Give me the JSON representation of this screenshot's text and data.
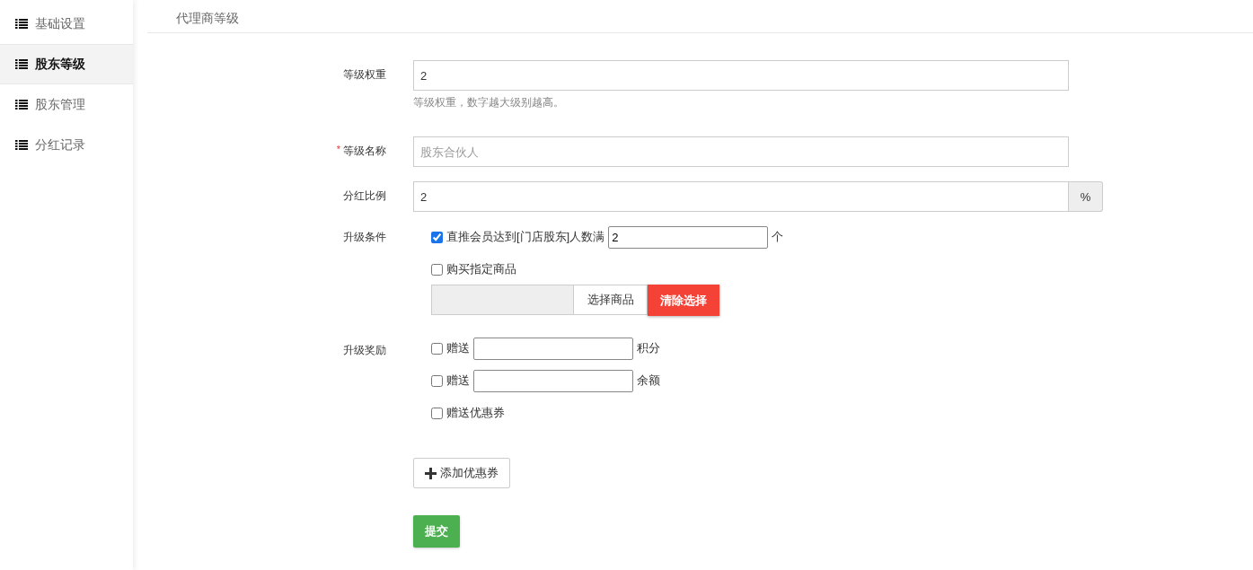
{
  "sidebar": {
    "items": [
      {
        "label": "基础设置",
        "selected": false
      },
      {
        "label": "股东等级",
        "selected": true
      },
      {
        "label": "股东管理",
        "selected": false
      },
      {
        "label": "分红记录",
        "selected": false
      }
    ]
  },
  "page_title": "代理商等级",
  "form": {
    "fields": [
      {
        "kind": "text",
        "label": "等级权重",
        "value": "2",
        "help": "等级权重，数字越大级别越高。"
      },
      {
        "kind": "text",
        "label": "等级名称",
        "required_mark": "*",
        "placeholder": "股东合伙人"
      },
      {
        "kind": "addon",
        "label": "分红比例",
        "value": "2",
        "addon": "%"
      }
    ],
    "upgrade_conditions": {
      "label": "升级条件",
      "options": [
        {
          "kind": "count",
          "checked": true,
          "label": "直推会员达到[门店股东]人数满",
          "value": "2",
          "unit": "个"
        },
        {
          "kind": "goods",
          "checked": false,
          "label": "购买指定商品"
        }
      ],
      "goods_picker": {
        "select_button": "选择商品",
        "clear_button": "清除选择"
      }
    },
    "rewards": {
      "label": "升级奖励",
      "options": [
        {
          "kind": "amount",
          "checked": false,
          "label": "赠送",
          "unit": "积分"
        },
        {
          "kind": "amount",
          "checked": false,
          "label": "赠送",
          "unit": "余额"
        },
        {
          "kind": "plain",
          "checked": false,
          "label": "赠送优惠券"
        }
      ]
    },
    "add_coupon_button": "添加优惠券",
    "submit_button": "提交"
  }
}
